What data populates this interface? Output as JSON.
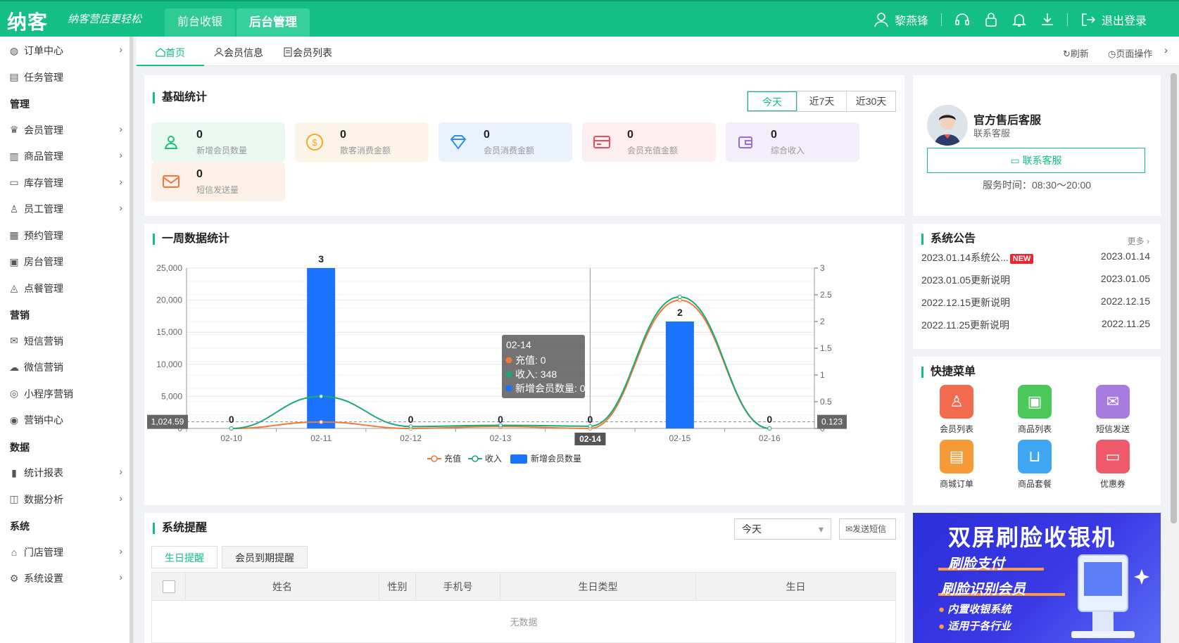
{
  "topbar": {
    "logo": "纳客",
    "slogan": "纳客营店更轻松",
    "tabs": [
      "前台收银",
      "后台管理"
    ],
    "user": "黎燕锋",
    "logout": "退出登录"
  },
  "sidebar": {
    "items": [
      {
        "label": "订单中心",
        "arrow": true
      },
      {
        "label": "任务管理",
        "arrow": false
      },
      {
        "group": "管理"
      },
      {
        "label": "会员管理",
        "arrow": true
      },
      {
        "label": "商品管理",
        "arrow": true
      },
      {
        "label": "库存管理",
        "arrow": true
      },
      {
        "label": "员工管理",
        "arrow": true
      },
      {
        "label": "预约管理",
        "arrow": false
      },
      {
        "label": "房台管理",
        "arrow": false
      },
      {
        "label": "点餐管理",
        "arrow": false
      },
      {
        "group": "营销"
      },
      {
        "label": "短信营销",
        "arrow": false
      },
      {
        "label": "微信营销",
        "arrow": false
      },
      {
        "label": "小程序营销",
        "arrow": false
      },
      {
        "label": "营销中心",
        "arrow": false
      },
      {
        "group": "数据"
      },
      {
        "label": "统计报表",
        "arrow": true
      },
      {
        "label": "数据分析",
        "arrow": true
      },
      {
        "group": "系统"
      },
      {
        "label": "门店管理",
        "arrow": true
      },
      {
        "label": "系统设置",
        "arrow": true
      }
    ]
  },
  "tabs": {
    "items": [
      "首页",
      "会员信息",
      "会员列表"
    ],
    "refresh": "刷新",
    "page_ops": "页面操作"
  },
  "basic_stats": {
    "title": "基础统计",
    "ranges": [
      "今天",
      "近7天",
      "近30天"
    ],
    "cards": [
      {
        "value": "0",
        "label": "新增会员数量",
        "color": "#1dbf84",
        "bg": "#e9f8f1"
      },
      {
        "value": "0",
        "label": "散客消费金额",
        "color": "#f5a623",
        "bg": "#fdf4e8"
      },
      {
        "value": "0",
        "label": "会员消费金额",
        "color": "#2d8cf0",
        "bg": "#eaf3fd"
      },
      {
        "value": "0",
        "label": "会员充值金额",
        "color": "#ef4b5b",
        "bg": "#fdeef0"
      },
      {
        "value": "0",
        "label": "综合收入",
        "color": "#9b6bd8",
        "bg": "#f4eefb"
      },
      {
        "value": "0",
        "label": "短信发送量",
        "color": "#f0793a",
        "bg": "#fdf0e8"
      }
    ]
  },
  "weekly": {
    "title": "一周数据统计",
    "legend": [
      "充值",
      "收入",
      "新增会员数量"
    ],
    "tooltip": {
      "title": "02-14",
      "rows": [
        "充值: 0",
        "收入: 348",
        "新增会员数量: 0"
      ]
    },
    "axis_left_label": "1,024.59",
    "axis_right_label": "0.123",
    "hover_x_label": "02-14"
  },
  "chart_data": {
    "type": "bar",
    "categories": [
      "02-10",
      "02-11",
      "02-12",
      "02-13",
      "02-14",
      "02-15",
      "02-16"
    ],
    "series": [
      {
        "name": "新增会员数量",
        "type": "bar",
        "axis": "right",
        "values": [
          0,
          3,
          0,
          0,
          0,
          2,
          0
        ]
      },
      {
        "name": "充值",
        "type": "line",
        "axis": "left",
        "values": [
          0,
          1000,
          0,
          300,
          0,
          20000,
          0
        ]
      },
      {
        "name": "收入",
        "type": "line",
        "axis": "left",
        "values": [
          0,
          5000,
          300,
          500,
          348,
          20500,
          0
        ]
      }
    ],
    "y_left": {
      "ticks": [
        "0",
        "5,000",
        "10,000",
        "15,000",
        "20,000",
        "25,000"
      ],
      "ylim": [
        0,
        25000
      ]
    },
    "y_right": {
      "ticks": [
        "0",
        "0.5",
        "1",
        "1.5",
        "2",
        "2.5",
        "3"
      ],
      "ylim": [
        0,
        3
      ]
    },
    "bar_labels": [
      "0",
      "3",
      "0",
      "0",
      "0",
      "2",
      "0"
    ],
    "grid": true,
    "legend": "bottom"
  },
  "customer_service": {
    "name": "官方售后客服",
    "sub": "联系客服",
    "button": "联系客服",
    "hours": "服务时间：08:30～20:00"
  },
  "notices": {
    "title": "系统公告",
    "more": "更多 ›",
    "new_tag": "NEW",
    "items": [
      {
        "title": "2023.01.14系统公...",
        "date": "2023.01.14",
        "new": true
      },
      {
        "title": "2023.01.05更新说明",
        "date": "2023.01.05"
      },
      {
        "title": "2022.12.15更新说明",
        "date": "2022.12.15"
      },
      {
        "title": "2022.11.25更新说明",
        "date": "2022.11.25"
      }
    ]
  },
  "quick_menu": {
    "title": "快捷菜单",
    "items": [
      {
        "label": "会员列表",
        "color": "#f36b4f"
      },
      {
        "label": "商品列表",
        "color": "#4cc85a"
      },
      {
        "label": "短信发送",
        "color": "#a77be0"
      },
      {
        "label": "商城订单",
        "color": "#f59a37"
      },
      {
        "label": "商品套餐",
        "color": "#3ea6f2"
      },
      {
        "label": "优惠券",
        "color": "#f0596a"
      }
    ]
  },
  "reminder": {
    "title": "系统提醒",
    "select_value": "今天",
    "send_sms": "发送短信",
    "subtabs": [
      "生日提醒",
      "会员到期提醒"
    ],
    "columns": [
      "姓名",
      "性别",
      "手机号",
      "生日类型",
      "生日"
    ],
    "empty": "无数据"
  },
  "ad": {
    "title": "双屏刷脸收银机",
    "line1": "刷脸支付",
    "line2": "刷脸识别会员",
    "bullets": [
      "内置收银系统",
      "适用于各行业"
    ]
  }
}
